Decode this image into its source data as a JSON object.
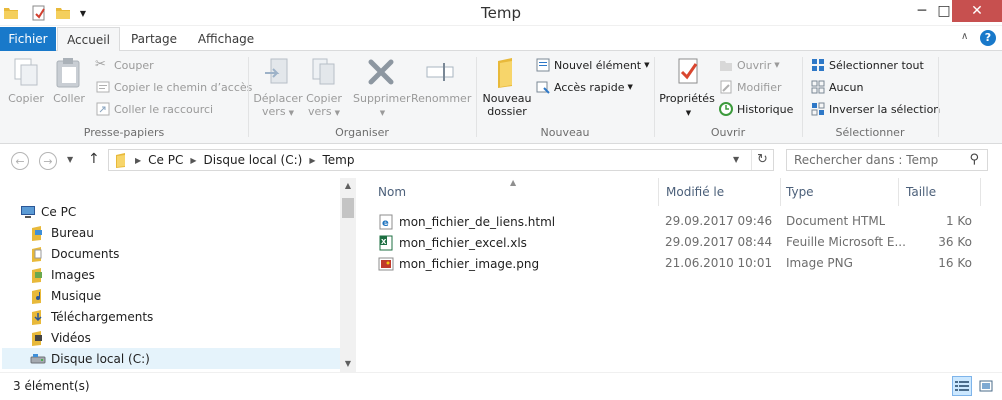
{
  "window": {
    "title": "Temp"
  },
  "ribbon_tabs": [
    {
      "label": "Fichier"
    },
    {
      "label": "Accueil"
    },
    {
      "label": "Partage"
    },
    {
      "label": "Affichage"
    }
  ],
  "ribbon": {
    "clipboard": {
      "label": "Presse-papiers",
      "copy": "Copier",
      "paste": "Coller",
      "cut": "Couper",
      "copy_path": "Copier le chemin d’accès",
      "paste_shortcut": "Coller le raccourci"
    },
    "organize": {
      "label": "Organiser",
      "move_to_1": "Déplacer",
      "move_to_2": "vers",
      "copy_to_1": "Copier",
      "copy_to_2": "vers",
      "delete": "Supprimer",
      "rename": "Renommer"
    },
    "new": {
      "label": "Nouveau",
      "new_folder_1": "Nouveau",
      "new_folder_2": "dossier",
      "new_item": "Nouvel élément",
      "easy_access": "Accès rapide"
    },
    "open": {
      "label": "Ouvrir",
      "properties": "Propriétés",
      "open": "Ouvrir",
      "edit": "Modifier",
      "history": "Historique"
    },
    "select": {
      "label": "Sélectionner",
      "select_all": "Sélectionner tout",
      "select_none": "Aucun",
      "invert": "Inverser la sélection"
    }
  },
  "address": {
    "crumbs": [
      "Ce PC",
      "Disque local (C:)",
      "Temp"
    ],
    "search_placeholder": "Rechercher dans : Temp"
  },
  "nav_tree": [
    {
      "label": "Ce PC"
    },
    {
      "label": "Bureau"
    },
    {
      "label": "Documents"
    },
    {
      "label": "Images"
    },
    {
      "label": "Musique"
    },
    {
      "label": "Téléchargements"
    },
    {
      "label": "Vidéos"
    },
    {
      "label": "Disque local (C:)"
    }
  ],
  "columns": {
    "name": "Nom",
    "modified": "Modifié le",
    "type": "Type",
    "size": "Taille"
  },
  "files": [
    {
      "name": "mon_fichier_de_liens.html",
      "modified": "29.09.2017 09:46",
      "type": "Document HTML",
      "size": "1 Ko"
    },
    {
      "name": "mon_fichier_excel.xls",
      "modified": "29.09.2017 08:44",
      "type": "Feuille Microsoft E...",
      "size": "36 Ko"
    },
    {
      "name": "mon_fichier_image.png",
      "modified": "21.06.2010 10:01",
      "type": "Image PNG",
      "size": "16 Ko"
    }
  ],
  "status": {
    "count": "3 élément(s)"
  },
  "colors": {
    "accent": "#1979ca",
    "close": "#c7504f",
    "selection": "#e5f3fb",
    "folder": "#e8b93a"
  }
}
